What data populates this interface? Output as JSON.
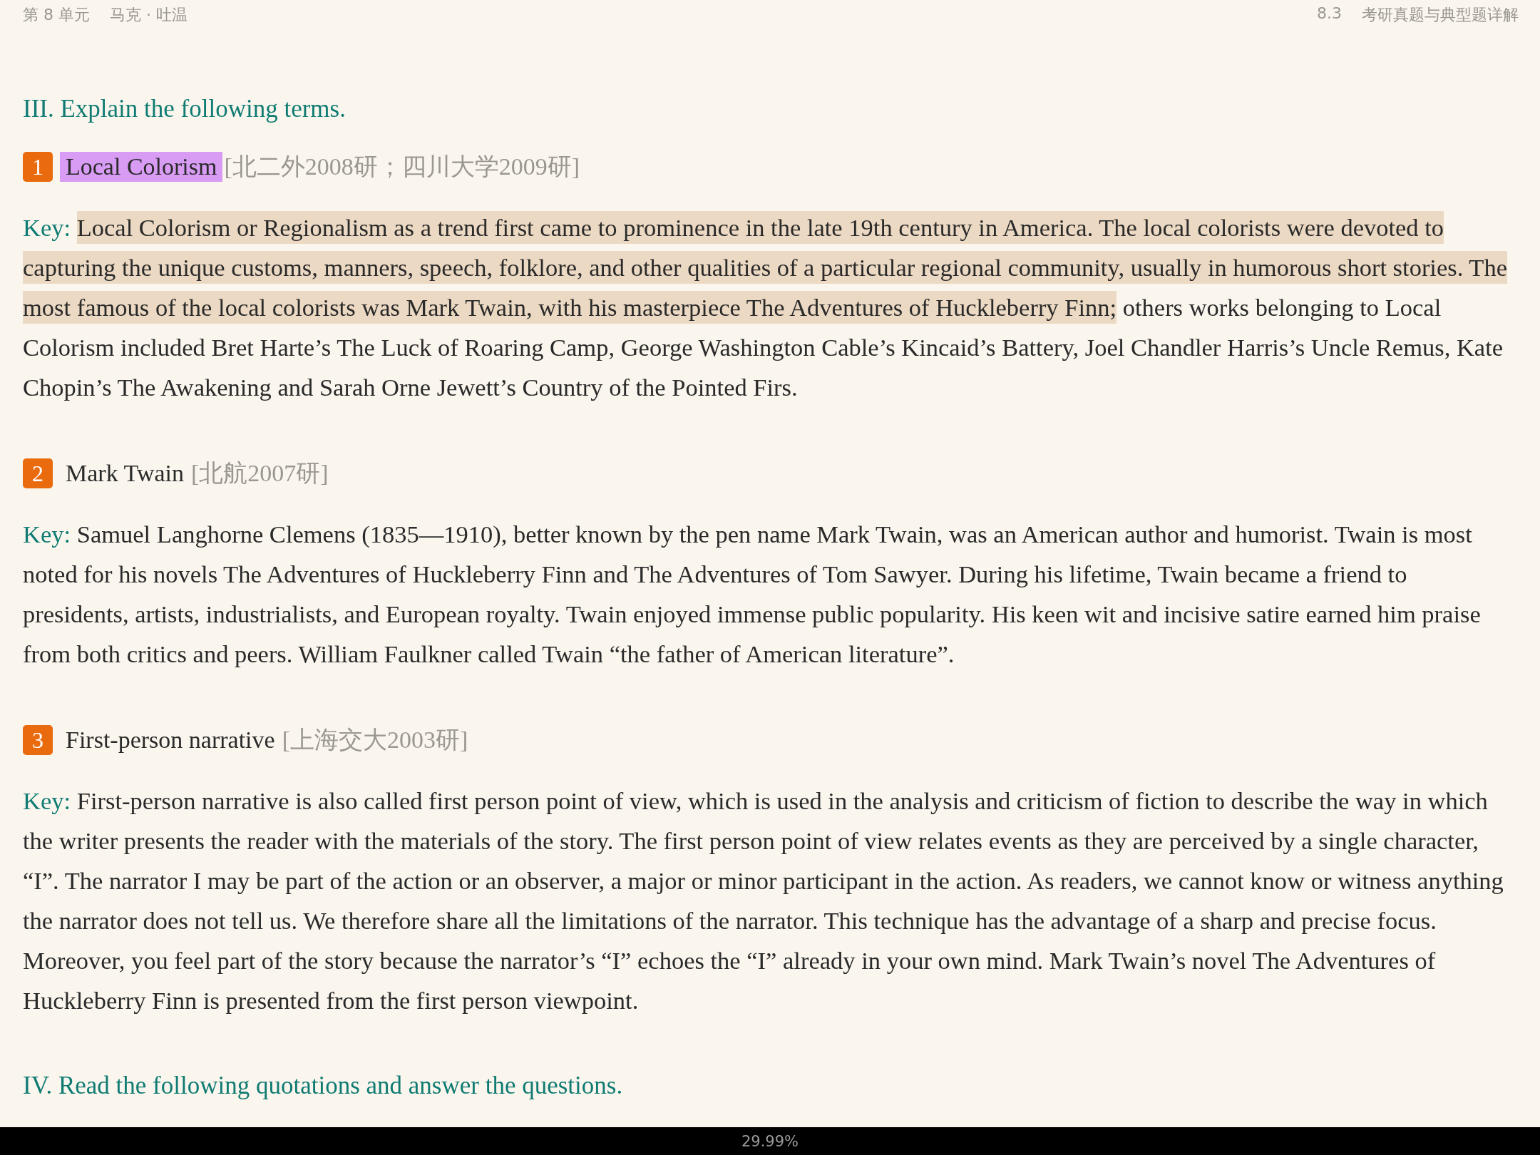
{
  "header": {
    "unit": "第 8 单元",
    "chapter": "马克 · 吐温",
    "section_number": "8.3",
    "section_title": "考研真题与典型题详解"
  },
  "sections": [
    {
      "heading": "III. Explain the following terms.",
      "items": [
        {
          "number": "1",
          "term": "Local Colorism",
          "highlighted": true,
          "source": "[北二外2008研；四川大学2009研]",
          "key_label": "Key:",
          "segments": [
            {
              "text": "Local Colorism or Regionalism as a trend first came to prominence in the late 19th century in America. The local colorists were devoted to capturing the unique customs, manners, speech, folklore, and other qualities of a particular regional community, usually in humorous short stories. The most famous of the local colorists was Mark Twain, with his masterpiece The Adventures of Huckleberry Finn;",
              "highlighted": true
            },
            {
              "text": " others works belonging to Local Colorism included Bret Harte’s The Luck of Roaring Camp, George Washington Cable’s Kincaid’s Battery, Joel Chandler Harris’s Uncle Remus, Kate Chopin’s The Awakening and Sarah Orne Jewett’s Country of the Pointed Firs.",
              "highlighted": false
            }
          ]
        },
        {
          "number": "2",
          "term": "Mark Twain",
          "highlighted": false,
          "source": "[北航2007研]",
          "key_label": "Key:",
          "segments": [
            {
              "text": "Samuel Langhorne Clemens (1835—1910), better known by the pen name Mark Twain, was an American author and humorist. Twain is most noted for his novels The Adventures of Huckleberry Finn and The Adventures of Tom Sawyer. During his lifetime, Twain became a friend to presidents, artists, industrialists, and European royalty. Twain enjoyed immense public popularity. His keen wit and incisive satire earned him praise from both critics and peers. William Faulkner called Twain “the father of American literature”.",
              "highlighted": false
            }
          ]
        },
        {
          "number": "3",
          "term": "First-person narrative",
          "highlighted": false,
          "source": "[上海交大2003研]",
          "key_label": "Key:",
          "segments": [
            {
              "text": "First-person narrative is also called first person point of view, which is used in the analysis and criticism of fiction to describe the way in which the writer presents the reader with the materials of the story. The first person point of view relates events as they are perceived by a single character, “I”. The narrator I may be part of the action or an observer, a major or minor participant in the action. As readers, we cannot know or witness anything the narrator does not tell us. We therefore share all the limitations of the narrator. This technique has the advantage of a sharp and precise focus. Moreover, you feel part of the story because the narrator’s “I” echoes the “I” already in your own mind. Mark Twain’s novel The Adventures of Huckleberry Finn is presented from the first person viewpoint.",
              "highlighted": false
            }
          ]
        }
      ]
    },
    {
      "heading": "IV. Read the following quotations and answer the questions."
    }
  ],
  "progress": "29.99%"
}
